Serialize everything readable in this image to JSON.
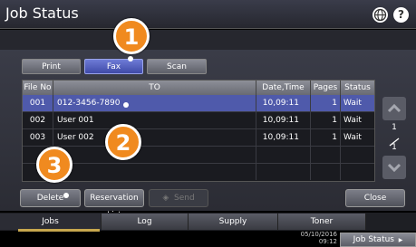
{
  "header": {
    "title": "Job Status",
    "globe_icon": "globe-icon",
    "help_icon": "help-icon",
    "help_glyph": "?"
  },
  "type_tabs": [
    {
      "label": "Print",
      "selected": false
    },
    {
      "label": "Fax",
      "selected": true
    },
    {
      "label": "Scan",
      "selected": false
    }
  ],
  "table": {
    "columns": [
      "File No",
      "TO",
      "Date,Time",
      "Pages",
      "Status"
    ],
    "rows": [
      {
        "file_no": "001",
        "to": "012-3456-7890",
        "datetime": "10,09:11",
        "pages": "1",
        "status": "Wait",
        "selected": true
      },
      {
        "file_no": "002",
        "to": "User 001",
        "datetime": "10,09:11",
        "pages": "1",
        "status": "Wait",
        "selected": false
      },
      {
        "file_no": "003",
        "to": "User 002",
        "datetime": "10,09:11",
        "pages": "1",
        "status": "Wait",
        "selected": false
      }
    ]
  },
  "pager": {
    "current": "1",
    "total": "1"
  },
  "actions": {
    "delete": "Delete",
    "reservation_list": "Reservation List",
    "send": "Send",
    "close": "Close"
  },
  "bottom_tabs": [
    {
      "label": "Jobs",
      "active": true
    },
    {
      "label": "Log",
      "active": false
    },
    {
      "label": "Supply",
      "active": false
    },
    {
      "label": "Toner",
      "active": false
    }
  ],
  "status_bar": {
    "date": "05/10/2016",
    "time": "09:12",
    "job_status_button": "Job Status"
  },
  "callouts": [
    "1",
    "2",
    "3"
  ],
  "colors": {
    "selected_row": "#4f5aab",
    "callout": "#f08a1f",
    "active_tab_underline": "#c7a74e"
  }
}
